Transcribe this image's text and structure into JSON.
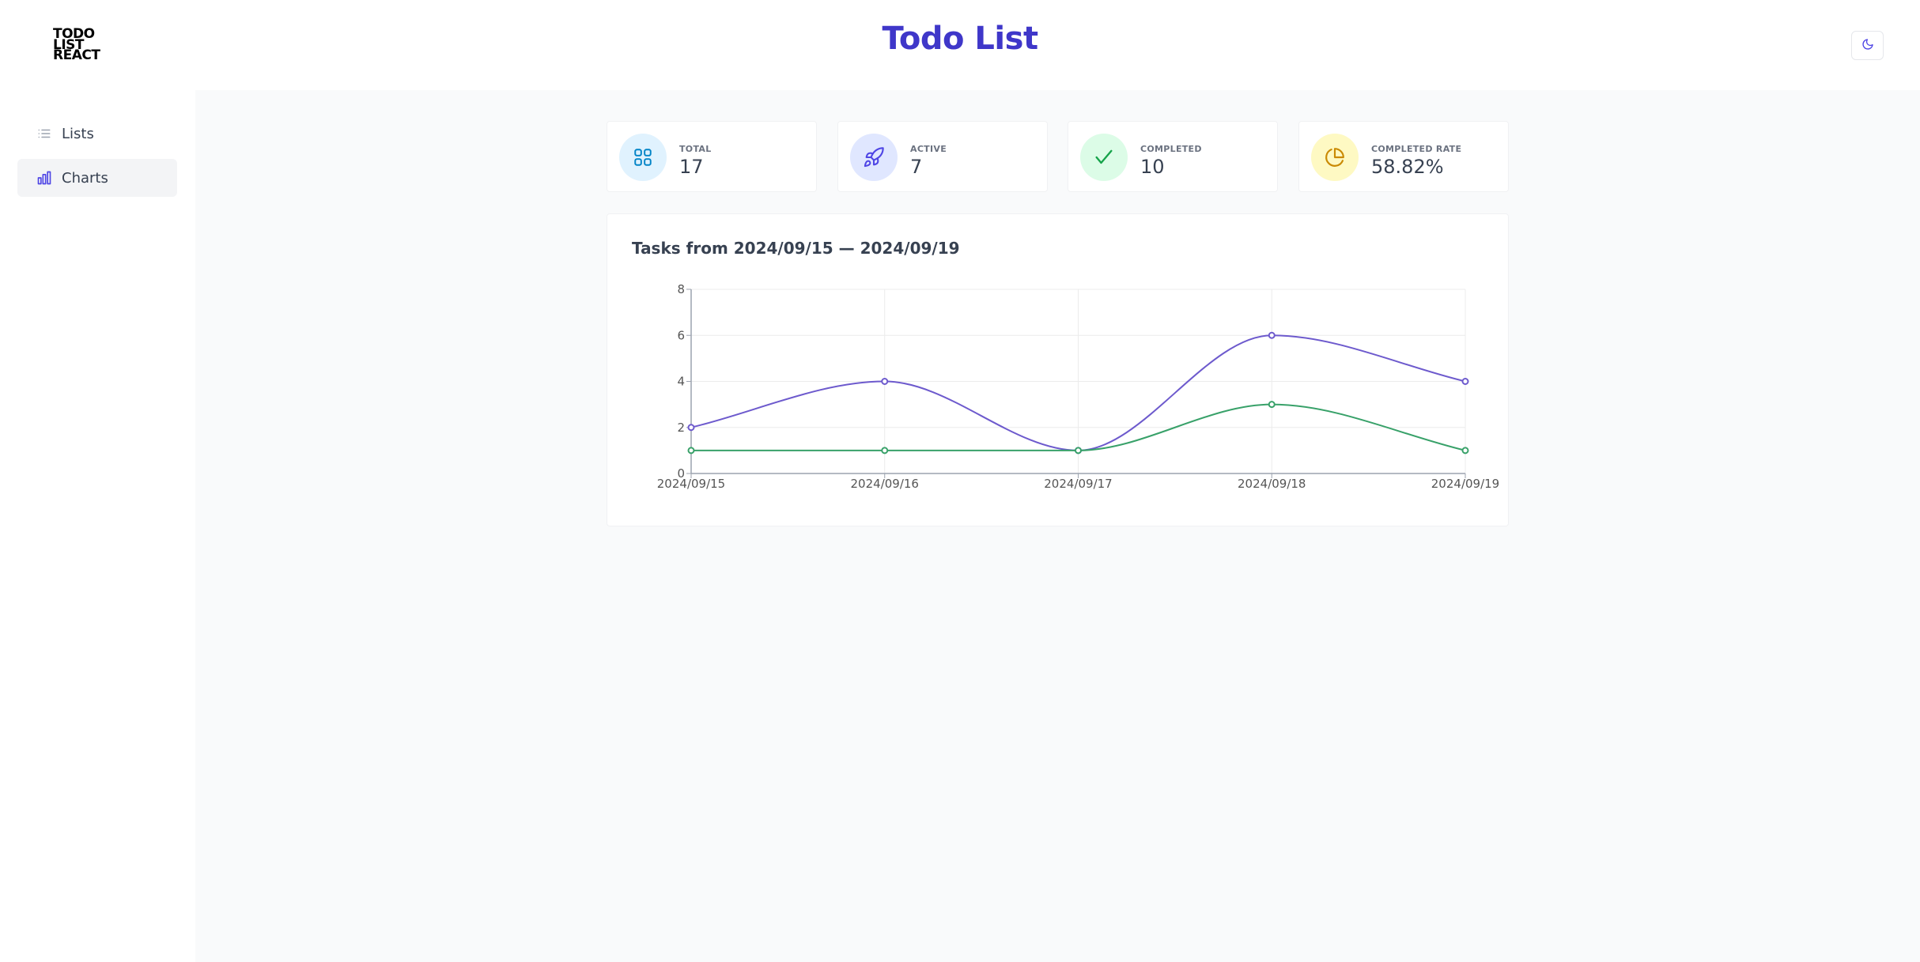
{
  "header": {
    "logo_lines": [
      "TODO",
      "LIST",
      "REACT"
    ],
    "title": "Todo List",
    "theme_icon": "moon-icon"
  },
  "sidebar": {
    "items": [
      {
        "label": "Lists",
        "icon": "list-icon",
        "active": false
      },
      {
        "label": "Charts",
        "icon": "bar-chart-icon",
        "active": true
      }
    ]
  },
  "stats": [
    {
      "label": "TOTAL",
      "value": "17",
      "icon": "grid-icon",
      "bg": "#e0f2fe",
      "color": "#0284c7"
    },
    {
      "label": "ACTIVE",
      "value": "7",
      "icon": "rocket-icon",
      "bg": "#e0e7ff",
      "color": "#4f46e5"
    },
    {
      "label": "COMPLETED",
      "value": "10",
      "icon": "check-icon",
      "bg": "#dcfce7",
      "color": "#16a34a"
    },
    {
      "label": "COMPLETED RATE",
      "value": "58.82%",
      "icon": "pie-icon",
      "bg": "#fef9c3",
      "color": "#ca8a04"
    }
  ],
  "chart": {
    "title": "Tasks from 2024/09/15 — 2024/09/19"
  },
  "chart_data": {
    "type": "line",
    "x": [
      "2024/09/15",
      "2024/09/16",
      "2024/09/17",
      "2024/09/18",
      "2024/09/19"
    ],
    "series": [
      {
        "values": [
          2,
          4,
          1,
          6,
          4
        ],
        "color": "#6d5acd"
      },
      {
        "values": [
          1,
          1,
          1,
          3,
          1
        ],
        "color": "#38a169"
      }
    ],
    "ylim": [
      0,
      8
    ],
    "yticks": [
      "0",
      "2",
      "4",
      "6",
      "8"
    ],
    "grid": true,
    "smooth": true
  }
}
